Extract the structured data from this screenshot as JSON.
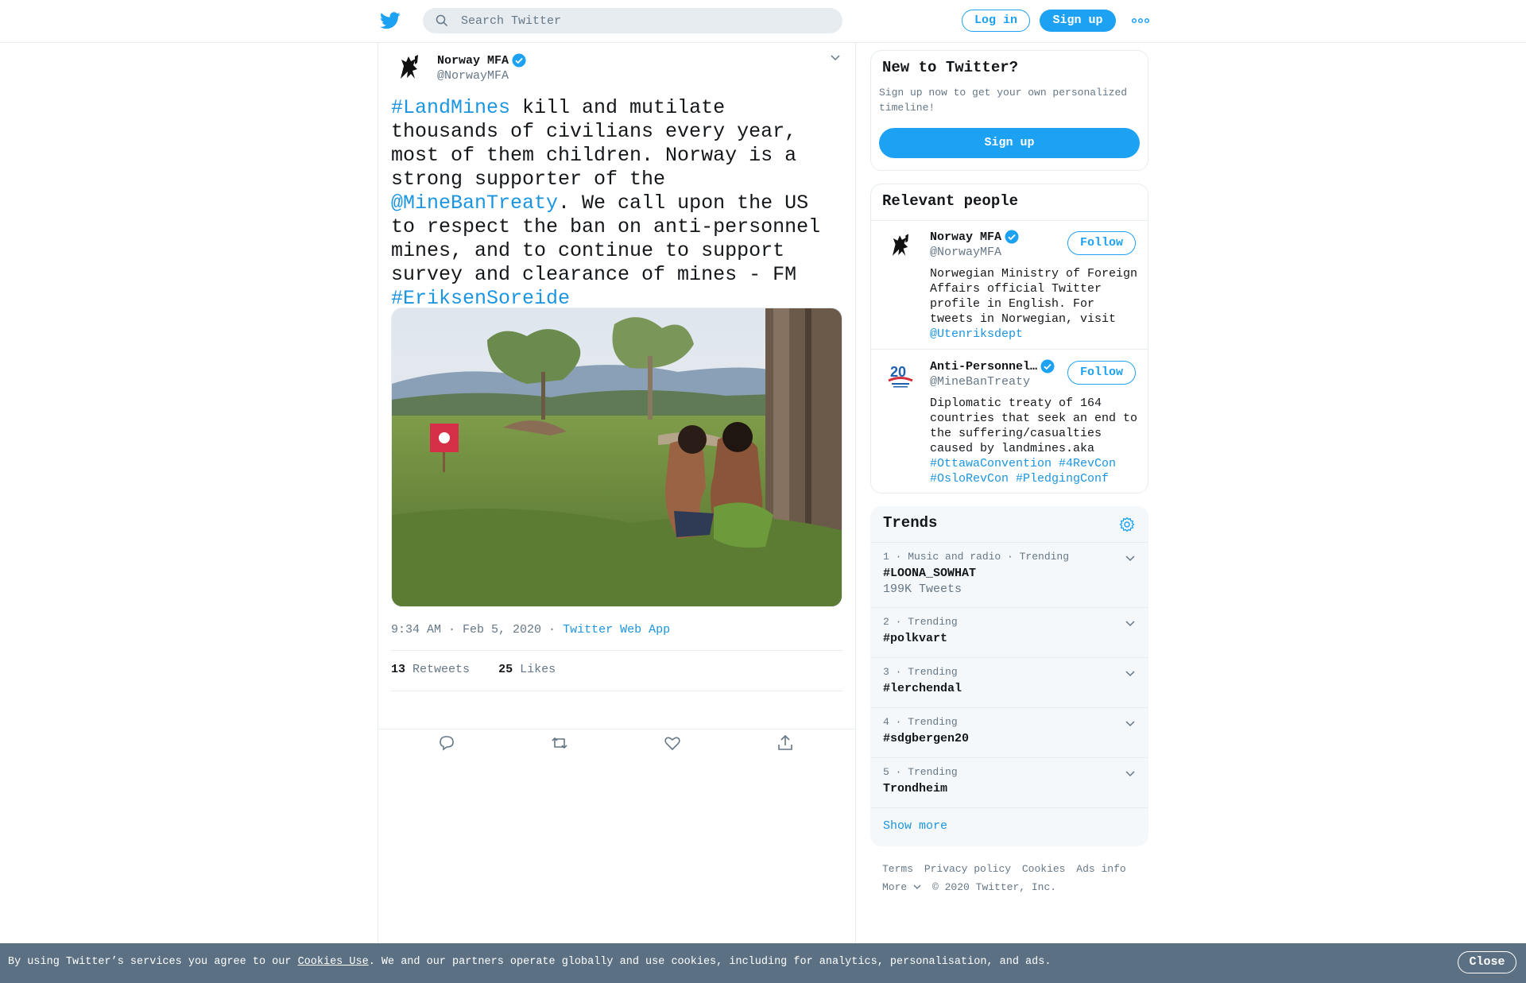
{
  "header": {
    "search_placeholder": "Search Twitter",
    "login_label": "Log in",
    "signup_label": "Sign up",
    "brand_color": "#1da1f2"
  },
  "tweet": {
    "author_name": "Norway MFA",
    "author_handle": "@NorwayMFA",
    "text_parts": [
      {
        "text": "#LandMines",
        "link": true
      },
      {
        "text": " kill and mutilate thousands of civilians every year, most of them children. Norway is a strong supporter of the ",
        "link": false
      },
      {
        "text": "@MineBanTreaty",
        "link": true
      },
      {
        "text": ". We call upon the US to respect the ban on anti-personnel mines, and to continue to support survey and clearance of mines - FM ",
        "link": false
      },
      {
        "text": "#EriksenSoreide",
        "link": true
      }
    ],
    "time": "9:34 AM · Feb 5, 2020",
    "source": "Twitter Web App",
    "retweets": "13",
    "retweets_label": "Retweets",
    "likes": "25",
    "likes_label": "Likes"
  },
  "sidebar": {
    "new_title": "New to Twitter?",
    "new_text": "Sign up now to get your own personalized timeline!",
    "new_signup": "Sign up",
    "relevant_title": "Relevant people",
    "people": [
      {
        "name": "Norway MFA",
        "handle": "@NorwayMFA",
        "follow": "Follow",
        "bio": "Norwegian Ministry of Foreign Affairs official Twitter profile in English. For tweets in Norwegian, visit ",
        "bio_link": "@Utenriksdept"
      },
      {
        "name": "Anti-Personnel…",
        "handle": "@MineBanTreaty",
        "follow": "Follow",
        "bio": "Diplomatic treaty of 164 countries that seek an end to the suffering/casualties caused by landmines.aka ",
        "bio_link": "#OttawaConvention #4RevCon #OsloRevCon #PledgingConf"
      }
    ],
    "trends_title": "Trends",
    "trends": [
      {
        "meta": "1 · Music and radio · Trending",
        "name": "#LOONA_SOWHAT",
        "count": "199K Tweets"
      },
      {
        "meta": "2 · Trending",
        "name": "#polkvart",
        "count": ""
      },
      {
        "meta": "3 · Trending",
        "name": "#lerchendal",
        "count": ""
      },
      {
        "meta": "4 · Trending",
        "name": "#sdgbergen20",
        "count": ""
      },
      {
        "meta": "5 · Trending",
        "name": "Trondheim",
        "count": ""
      }
    ],
    "show_more": "Show more",
    "footer_links": [
      "Terms",
      "Privacy policy",
      "Cookies",
      "Ads info"
    ],
    "footer_more": "More",
    "copyright": "© 2020 Twitter, Inc."
  },
  "cookie_bar": {
    "prefix": "By using Twitter’s services you agree to our ",
    "link": "Cookies Use",
    "suffix": ". We and our partners operate globally and use cookies, including for analytics, personalisation, and ads.",
    "close": "Close"
  }
}
